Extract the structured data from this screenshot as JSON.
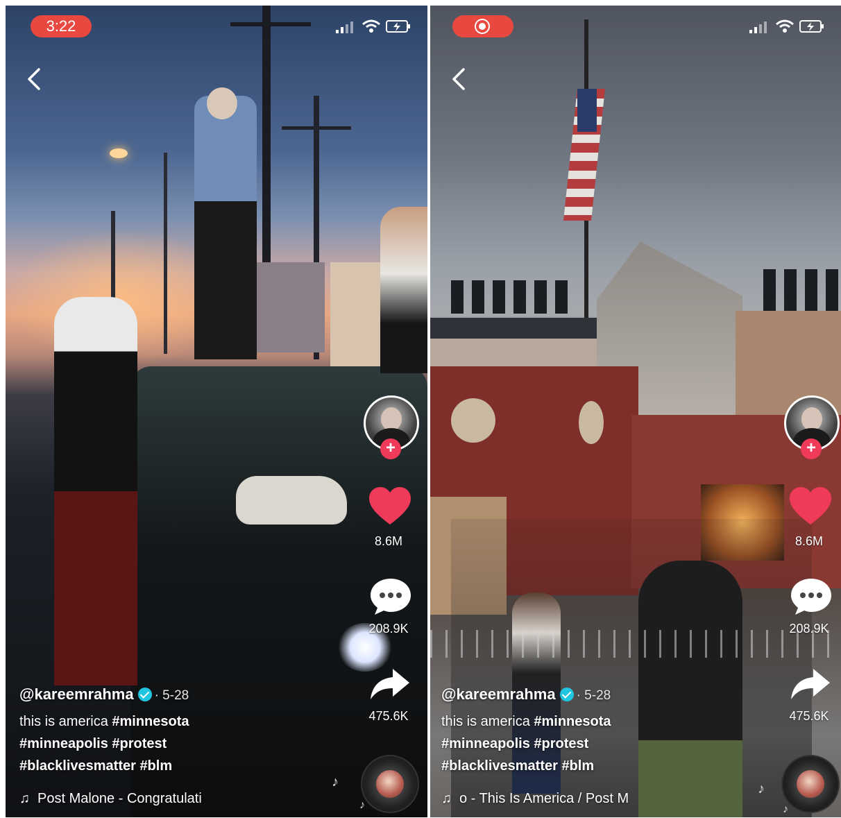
{
  "left": {
    "status": {
      "time": "3:22"
    },
    "actions": {
      "likes": "8.6M",
      "comments": "208.9K",
      "shares": "475.6K"
    },
    "caption": {
      "username": "@kareemrahma",
      "date": "· 5-28",
      "line1_plain": "this is america ",
      "line1_tag": "#minnesota",
      "line2": "#minneapolis #protest",
      "line3": "#blacklivesmatter #blm"
    },
    "music": {
      "note_icon": "♫",
      "text": "Post Malone - Congratulati"
    }
  },
  "right": {
    "status": {
      "record_icon": "record-icon"
    },
    "actions": {
      "likes": "8.6M",
      "comments": "208.9K",
      "shares": "475.6K"
    },
    "caption": {
      "username": "@kareemrahma",
      "date": "· 5-28",
      "line1_plain": "this is america ",
      "line1_tag": "#minnesota",
      "line2": "#minneapolis #protest",
      "line3": "#blacklivesmatter #blm"
    },
    "music": {
      "note_icon": "♫",
      "text": "o - This Is America / Post M"
    }
  },
  "colors": {
    "accent_red": "#e8483f",
    "like_red": "#ef3a59",
    "verified_blue": "#20c5e0"
  }
}
